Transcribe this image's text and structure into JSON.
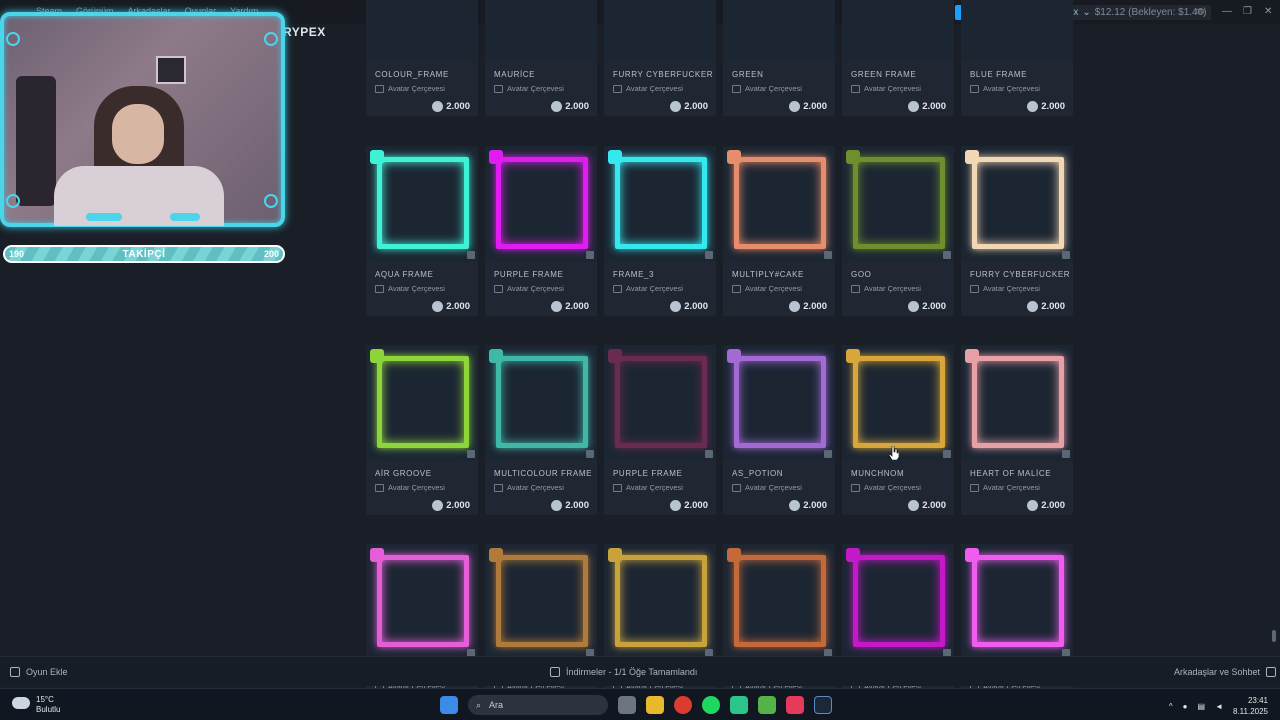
{
  "topbar": {
    "nav": [
      "Steam",
      "Görünüm",
      "Arkadaşlar",
      "Oyunlar",
      "Yardım"
    ],
    "brand": "RYPEX",
    "account": {
      "name": "Rypex",
      "balance": "$12.12 (Bekleyen: $1.46)"
    }
  },
  "webcam": {
    "followers_current": "190",
    "followers_label": "TAKİPÇİ",
    "followers_goal": "200",
    "progress": 0.95
  },
  "shop": {
    "type_label": "Avatar Çerçevesi",
    "price": "2.000",
    "rows": [
      [
        {
          "name": "COLOUR_FRAME"
        },
        {
          "name": "MAURİCE"
        },
        {
          "name": "FURRY CYBERFUCKER GLI"
        },
        {
          "name": "GREEN"
        },
        {
          "name": "GREEN FRAME"
        },
        {
          "name": "BLUE FRAME"
        }
      ],
      [
        {
          "name": "AQUA FRAME",
          "color": "#3ff2d6"
        },
        {
          "name": "PURPLE FRAME",
          "color": "#e01df0"
        },
        {
          "name": "FRAME_3",
          "color": "#35e8ee"
        },
        {
          "name": "MULTIPLY#CAKE",
          "color": "#e88d6c"
        },
        {
          "name": "GOO",
          "color": "#6f8f2e"
        },
        {
          "name": "FURRY CYBERFUCKER SH",
          "color": "#f1d7b4"
        }
      ],
      [
        {
          "name": "AİR GROOVE",
          "color": "#8ed43b"
        },
        {
          "name": "MULTICOLOUR FRAME",
          "color": "#3fb8a8"
        },
        {
          "name": "PURPLE FRAME",
          "color": "#6a2b52"
        },
        {
          "name": "AS_POTION",
          "color": "#a36ad6"
        },
        {
          "name": "MUNCHNOM",
          "color": "#d8a63a"
        },
        {
          "name": "HEART OF MALİCE",
          "color": "#e7a0a6"
        }
      ],
      [
        {
          "name": "",
          "color": "#e65ed7"
        },
        {
          "name": "",
          "color": "#b07a3a"
        },
        {
          "name": "",
          "color": "#c9a23b"
        },
        {
          "name": "",
          "color": "#c46a3a"
        },
        {
          "name": "",
          "color": "#c419c8"
        },
        {
          "name": "",
          "color": "#f05cf0"
        }
      ]
    ]
  },
  "bottombar": {
    "add_game": "Oyun Ekle",
    "downloads": "İndirmeler - 1/1 Öğe Tamamlandı",
    "friends": "Arkadaşlar ve Sohbet"
  },
  "taskbar": {
    "temperature": "15°C",
    "weather": "Bulutlu",
    "search_placeholder": "Ara",
    "time": "23:41",
    "date": "8.11.2025"
  }
}
